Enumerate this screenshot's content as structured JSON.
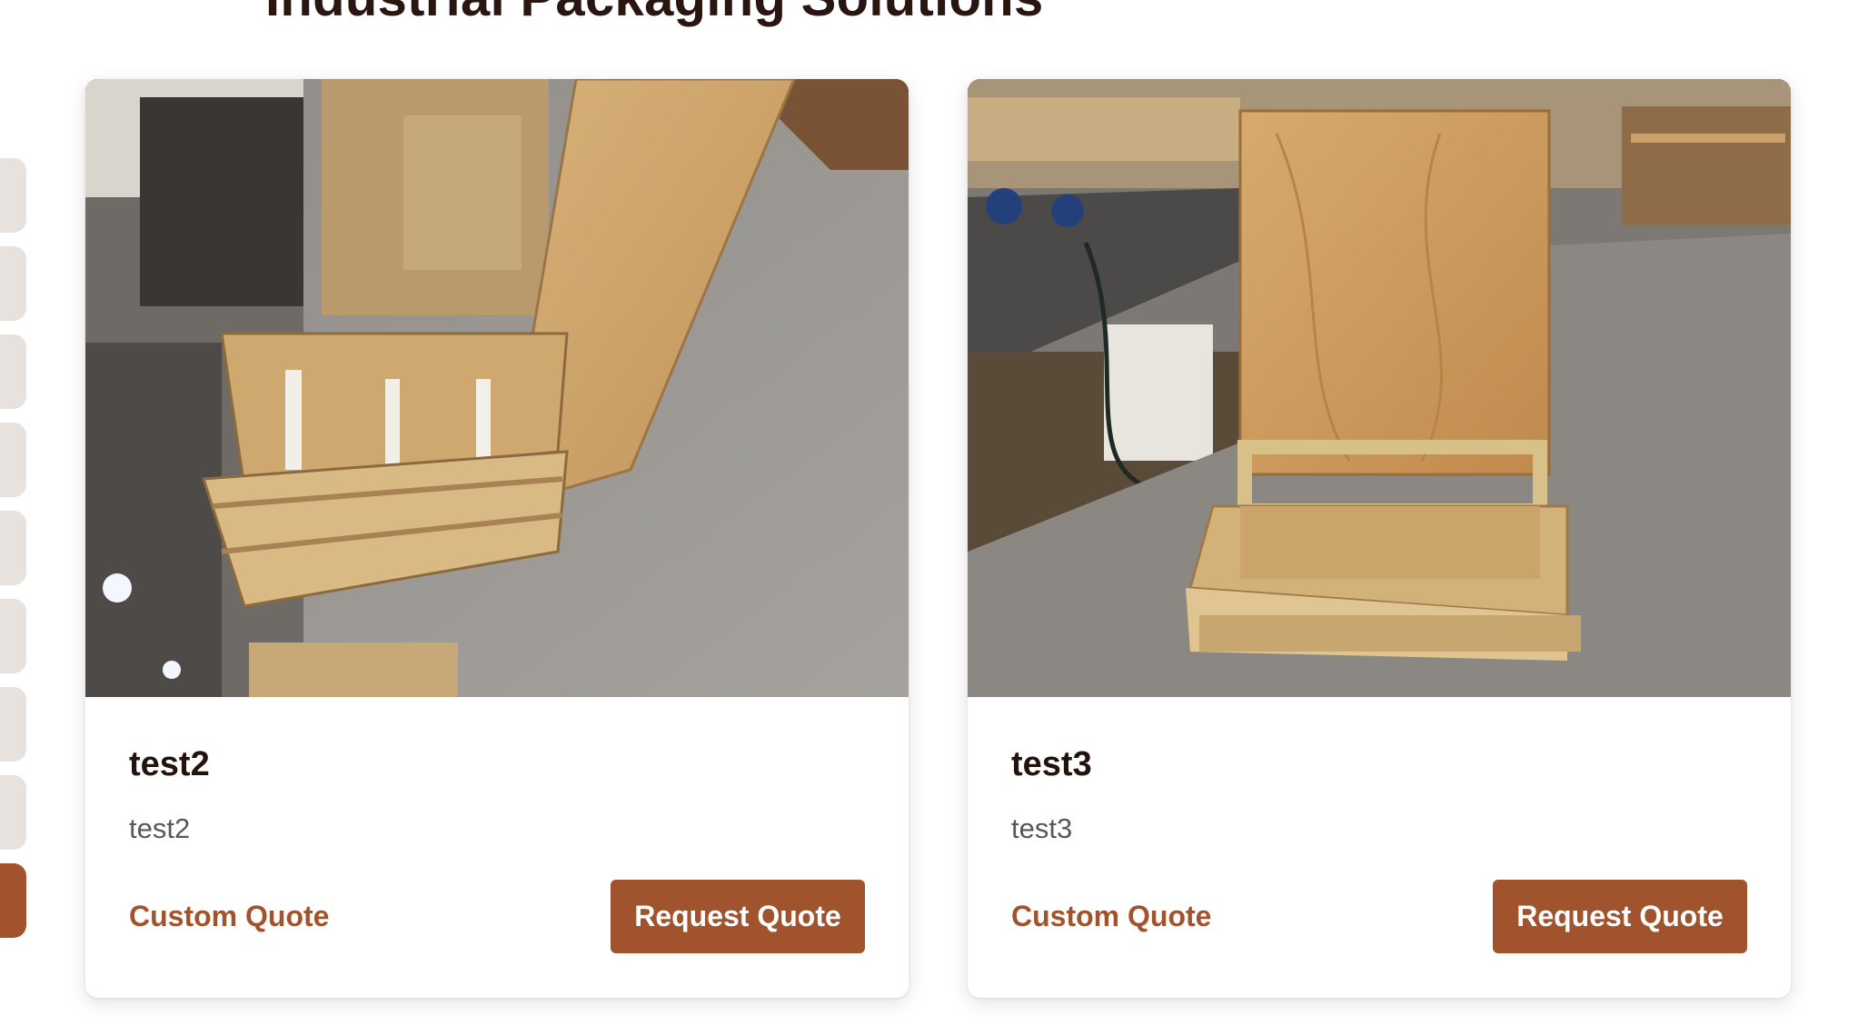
{
  "section": {
    "title": "Industrial Packaging Solutions"
  },
  "colors": {
    "accent": "#a0532d",
    "tab_inactive": "#e8e2df",
    "title_text": "#24120d",
    "desc_text": "#55585f"
  },
  "side_tabs": [
    {
      "active": false
    },
    {
      "active": false
    },
    {
      "active": false
    },
    {
      "active": false
    },
    {
      "active": false
    },
    {
      "active": false
    },
    {
      "active": false
    },
    {
      "active": false
    },
    {
      "active": true
    }
  ],
  "cards": [
    {
      "title": "test2",
      "description": "test2",
      "image_alt": "Open plywood crate with hinged lid on a warehouse floor",
      "custom_quote_label": "Custom Quote",
      "request_quote_label": "Request Quote"
    },
    {
      "title": "test3",
      "description": "test3",
      "image_alt": "Plywood panel standing on a wooden pallet crate base in a workshop",
      "custom_quote_label": "Custom Quote",
      "request_quote_label": "Request Quote"
    }
  ]
}
